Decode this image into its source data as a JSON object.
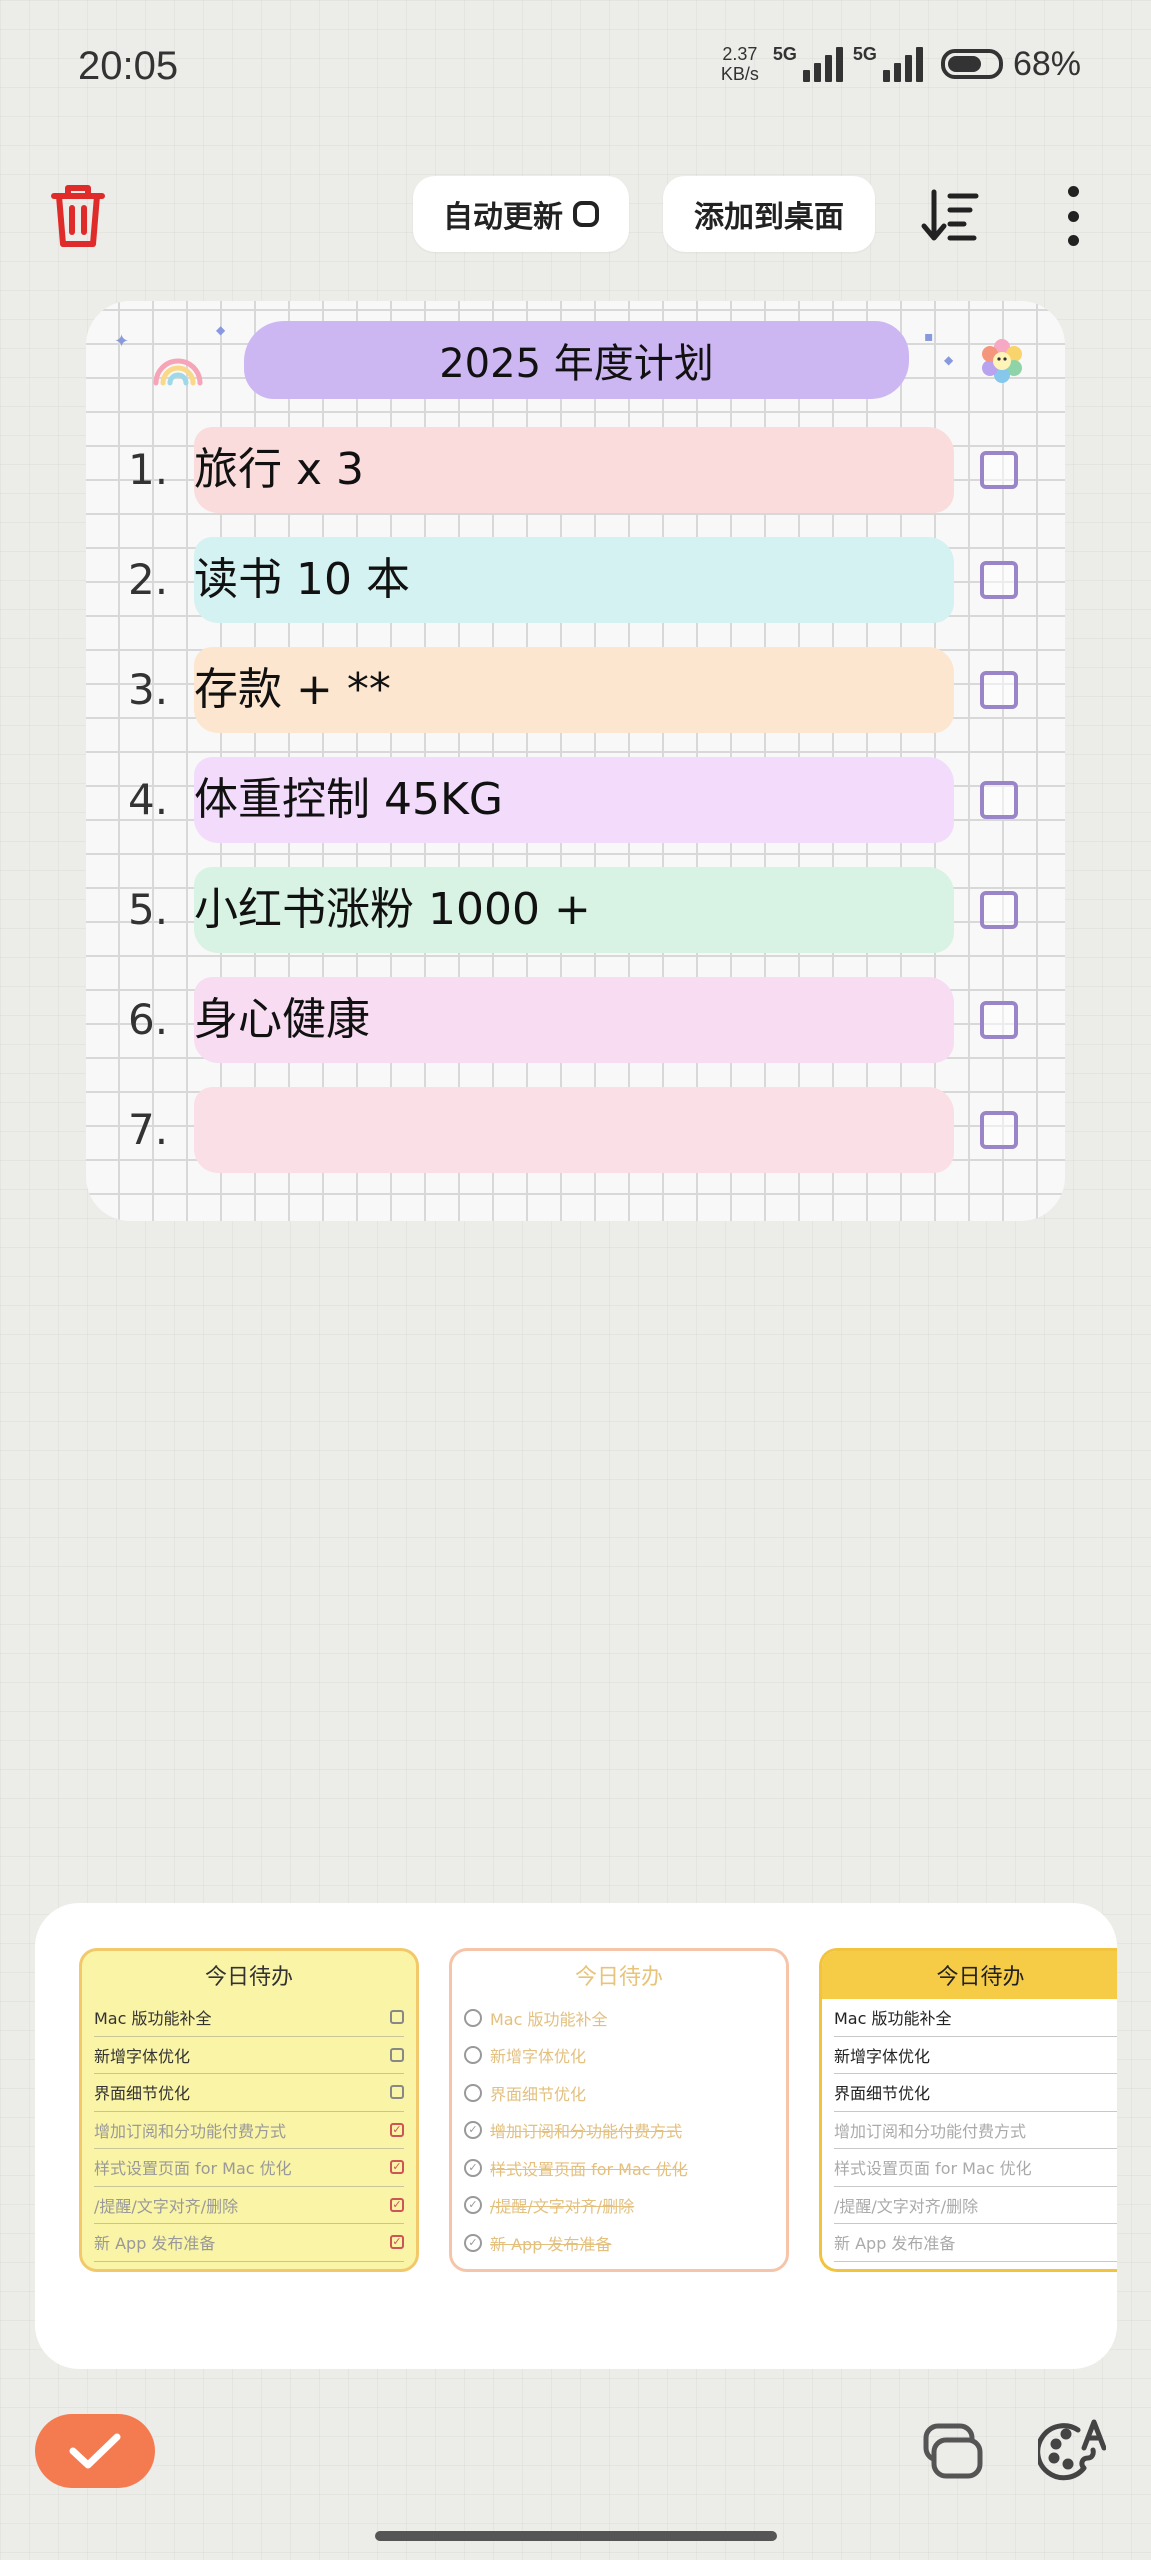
{
  "status_bar": {
    "time": "20:05",
    "net_speed_value": "2.37",
    "net_speed_unit": "KB/s",
    "network_1": "5G",
    "network_2": "5G",
    "battery_percent": "68%",
    "battery_level": 0.68
  },
  "toolbar": {
    "trash_icon": "trash-icon",
    "auto_update_label": "自动更新",
    "add_to_desktop_label": "添加到桌面",
    "sort_icon": "sort-icon",
    "more_icon": "more-vertical-icon",
    "trash_color": "#e02b2b"
  },
  "plan_card": {
    "title": "2025 年度计划",
    "title_color": "#cdb7f3",
    "items": [
      {
        "num": "1.",
        "text": "旅行 x 3",
        "color": "#fbdcdc",
        "checked": false
      },
      {
        "num": "2.",
        "text": "读书 10 本",
        "color": "#d4f2f1",
        "checked": false
      },
      {
        "num": "3.",
        "text": "存款 + **",
        "color": "#fce6cf",
        "checked": false
      },
      {
        "num": "4.",
        "text": "体重控制 45KG",
        "color": "#f3dcfb",
        "checked": false
      },
      {
        "num": "5.",
        "text": "小红书涨粉 1000 +",
        "color": "#d8f3e3",
        "checked": false
      },
      {
        "num": "6.",
        "text": "身心健康",
        "color": "#f8dcf1",
        "checked": false
      },
      {
        "num": "7.",
        "text": "",
        "color": "#fbdfe6",
        "checked": false
      }
    ]
  },
  "style_picker": {
    "templates": [
      {
        "title": "今日待办",
        "rows": [
          {
            "text": "Mac 版功能补全",
            "done": false
          },
          {
            "text": "新增字体优化",
            "done": false
          },
          {
            "text": "界面细节优化",
            "done": false
          },
          {
            "text": "增加订阅和分功能付费方式",
            "done": true
          },
          {
            "text": "样式设置页面 for Mac 优化",
            "done": true
          },
          {
            "text": "/提醒/文字对齐/删除",
            "done": true
          },
          {
            "text": "新 App 发布准备",
            "done": true
          }
        ]
      },
      {
        "title": "今日待办",
        "rows": [
          {
            "text": "Mac 版功能补全",
            "done": false
          },
          {
            "text": "新增字体优化",
            "done": false
          },
          {
            "text": "界面细节优化",
            "done": false
          },
          {
            "text": "增加订阅和分功能付费方式",
            "done": true
          },
          {
            "text": "样式设置页面 for Mac 优化",
            "done": true
          },
          {
            "text": "/提醒/文字对齐/删除",
            "done": true
          },
          {
            "text": "新 App 发布准备",
            "done": true
          }
        ]
      },
      {
        "title": "今日待办",
        "rows": [
          {
            "text": "Mac 版功能补全",
            "done": false
          },
          {
            "text": "新增字体优化",
            "done": false
          },
          {
            "text": "界面细节优化",
            "done": false
          },
          {
            "text": "增加订阅和分功能付费方式",
            "done": true
          },
          {
            "text": "样式设置页面 for Mac 优化",
            "done": true
          },
          {
            "text": "/提醒/文字对齐/删除",
            "done": true
          },
          {
            "text": "新 App 发布准备",
            "done": true
          }
        ]
      }
    ]
  },
  "bottom_actions": {
    "confirm_icon": "checkmark-icon",
    "confirm_color": "#f47b50",
    "layers_icon": "layers-icon",
    "palette_icon": "palette-icon"
  }
}
